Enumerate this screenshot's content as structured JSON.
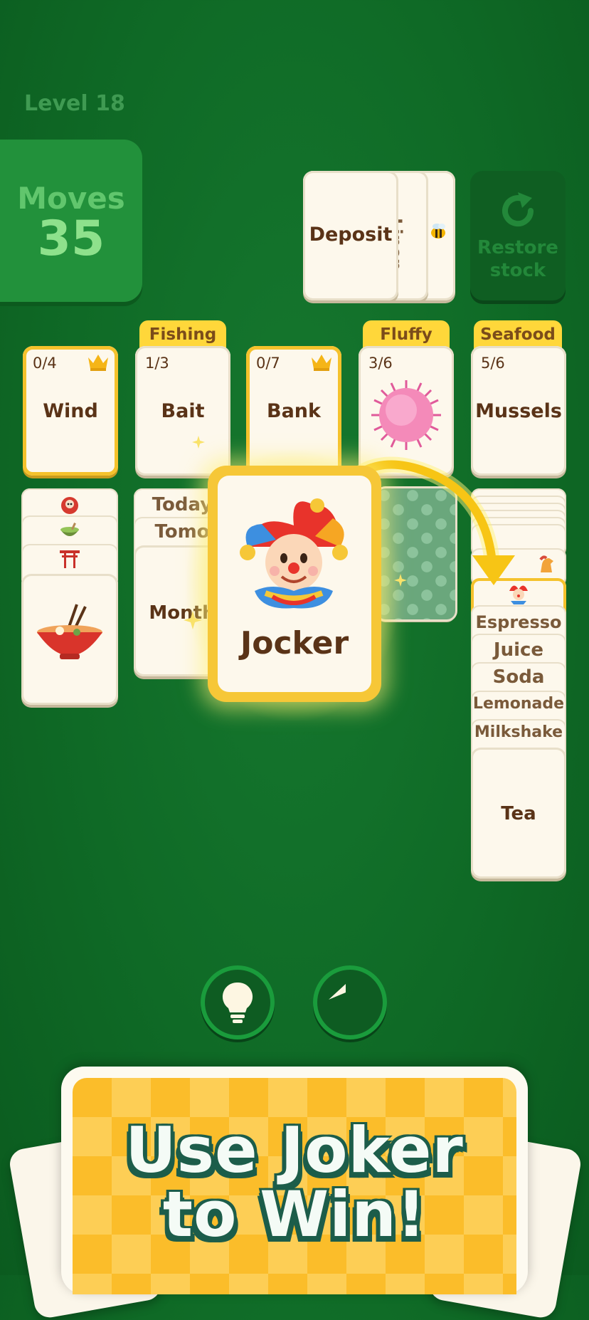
{
  "header": {
    "level": "Level 18",
    "moves_label": "Moves",
    "moves_value": "35"
  },
  "stock": {
    "top_card": "Deposit",
    "second_card": "Linen",
    "restore_label_1": "Restore",
    "restore_label_2": "stock"
  },
  "foundations": [
    {
      "tag": "",
      "count": "0/4",
      "title": "Wind",
      "crown": true
    },
    {
      "tag": "Fishing",
      "count": "1/3",
      "title": "Bait",
      "crown": false
    },
    {
      "tag": "",
      "count": "0/7",
      "title": "Bank",
      "crown": true
    },
    {
      "tag": "Fluffy",
      "count": "3/6",
      "title": "",
      "crown": false,
      "image": "pink-pompom"
    },
    {
      "tag": "Seafood",
      "count": "5/6",
      "title": "Mussels",
      "crown": false
    }
  ],
  "column1": {
    "icons": [
      "daruma-icon",
      "matcha-icon",
      "torii-icon"
    ],
    "bottom_image": "ramen-icon"
  },
  "column2": {
    "rows": [
      "Today",
      "Tomo"
    ],
    "bottom": "Month"
  },
  "joker": {
    "title": "Jocker"
  },
  "column5": {
    "icons": [
      "pony-icon",
      "jester-icon"
    ],
    "rows": [
      "Espresso",
      "Juice",
      "Soda",
      "Lemonade",
      "Milkshake"
    ],
    "bottom": "Tea"
  },
  "controls": {
    "hint": "lightbulb-icon",
    "undo": "undo-icon"
  },
  "banner": {
    "line1": "Use Joker",
    "line2": "to Win!"
  },
  "colors": {
    "background": "#11702a",
    "gold": "#f5c22c",
    "card": "#fdf8ec",
    "banner": "#fbbd2a"
  }
}
